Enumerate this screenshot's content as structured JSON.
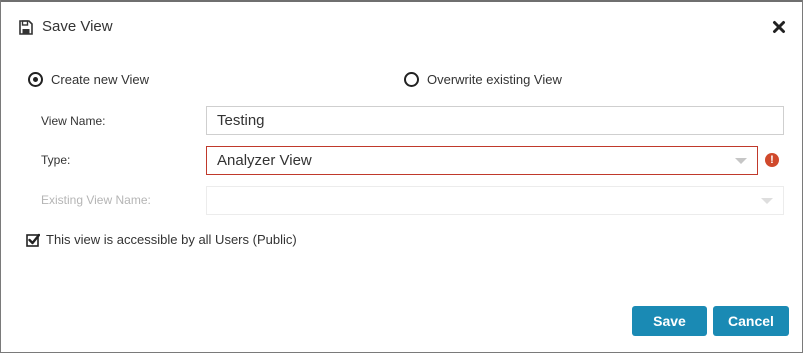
{
  "dialog": {
    "title": "Save View",
    "icons": {
      "title_icon": "floppy-disk-icon",
      "close_icon": "close-icon"
    }
  },
  "mode": {
    "options": [
      {
        "label": "Create new View",
        "checked": true
      },
      {
        "label": "Overwrite existing View",
        "checked": false
      }
    ]
  },
  "form": {
    "view_name": {
      "label": "View Name:",
      "value": "Testing"
    },
    "type": {
      "label": "Type:",
      "value": "Analyzer View",
      "error": true,
      "error_icon": "exclamation-circle-icon"
    },
    "existing_view_name": {
      "label": "Existing View Name:",
      "value": "",
      "disabled": true
    }
  },
  "public_access": {
    "label": "This view is accessible by all Users (Public)",
    "checked": true
  },
  "buttons": {
    "save_label": "Save",
    "cancel_label": "Cancel"
  },
  "colors": {
    "primary_button": "#1a8ab4",
    "error": "#c0392b",
    "error_icon": "#d0492c"
  }
}
